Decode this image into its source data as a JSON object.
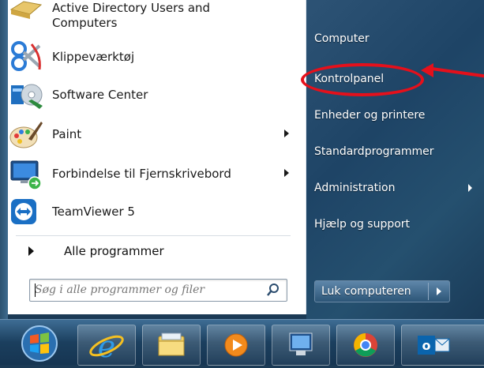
{
  "programs": [
    {
      "label_line1": "Active Directory Users and",
      "label_line2": "Computers",
      "icon": "active-directory-icon",
      "has_submenu": false
    },
    {
      "label": "Klippeværktøj",
      "icon": "snipping-tool-icon",
      "has_submenu": false
    },
    {
      "label": "Software Center",
      "icon": "software-center-icon",
      "has_submenu": false
    },
    {
      "label": "Paint",
      "icon": "paint-icon",
      "has_submenu": true
    },
    {
      "label": "Forbindelse til Fjernskrivebord",
      "icon": "remote-desktop-icon",
      "has_submenu": true
    },
    {
      "label": "TeamViewer 5",
      "icon": "teamviewer-icon",
      "has_submenu": false
    }
  ],
  "all_programs_label": "Alle programmer",
  "search": {
    "placeholder": "Søg i alle programmer og filer"
  },
  "right_items": [
    {
      "label": "Computer",
      "has_submenu": false
    },
    {
      "label": "Kontrolpanel",
      "has_submenu": false
    },
    {
      "label": "Enheder og printere",
      "has_submenu": false
    },
    {
      "label": "Standardprogrammer",
      "has_submenu": false
    },
    {
      "label": "Administration",
      "has_submenu": true
    },
    {
      "label": "Hjælp og support",
      "has_submenu": false
    }
  ],
  "shutdown_label": "Luk computeren",
  "taskbar_items": [
    "start-orb-icon",
    "internet-explorer-icon",
    "windows-explorer-icon",
    "media-player-icon",
    "remote-desktop-icon",
    "chrome-icon",
    "outlook-icon"
  ],
  "colors": {
    "annotation": "#e5101b",
    "right_pane": "#1e4466"
  }
}
